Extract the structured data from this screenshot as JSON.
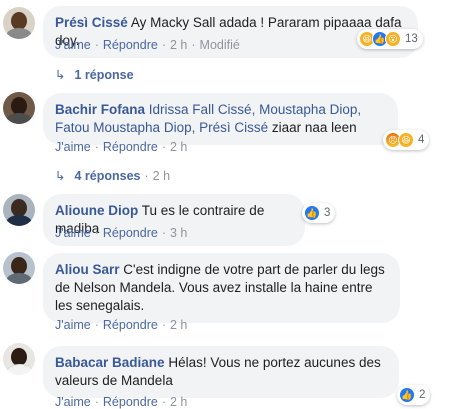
{
  "comments": [
    {
      "author": "Présì Cissé",
      "tags": "",
      "text": "Ay Macky Sall adada ! Pararam pipaaaa dafa doy.",
      "like_label": "J'aime",
      "reply_label": "Répondre",
      "time": "2 h",
      "edited": "Modifié",
      "reactions": [
        "haha-icon",
        "like-icon",
        "wow-icon"
      ],
      "reaction_count": "13",
      "replies_label": "1 réponse"
    },
    {
      "author": "Bachir Fofana",
      "tags": "Idrissa Fall Cissé, Moustapha Diop, Fatou Moustapha Diop, Présì Cissé",
      "text": "ziaar naa leen",
      "like_label": "J'aime",
      "reply_label": "Répondre",
      "time": "2 h",
      "reactions": [
        "angry-icon",
        "haha-icon"
      ],
      "reaction_count": "4",
      "replies_label": "4 réponses",
      "replies_time": "2 h"
    },
    {
      "author": "Alioune Diop",
      "text": "Tu es le contraire de madiba",
      "like_label": "J'aime",
      "reply_label": "Répondre",
      "time": "3 h",
      "reactions": [
        "like-icon"
      ],
      "reaction_count": "3"
    },
    {
      "author": "Aliou Sarr",
      "text": "C'est indigne de votre part de parler du legs de Nelson Mandela. Vous avez installe la haine entre les senegalais.",
      "like_label": "J'aime",
      "reply_label": "Répondre",
      "time": "2 h"
    },
    {
      "author": "Babacar Badiane",
      "text": "Hélas! Vous ne portez aucunes des valeurs de Mandela",
      "like_label": "J'aime",
      "reply_label": "Répondre",
      "time": "2 h",
      "reactions": [
        "like-icon"
      ],
      "reaction_count": "2"
    }
  ],
  "colors": {
    "link": "#385898",
    "bubble": "#f2f3f5",
    "like": "#2078f4",
    "haha": "#f7b125",
    "muted": "#90949c"
  }
}
